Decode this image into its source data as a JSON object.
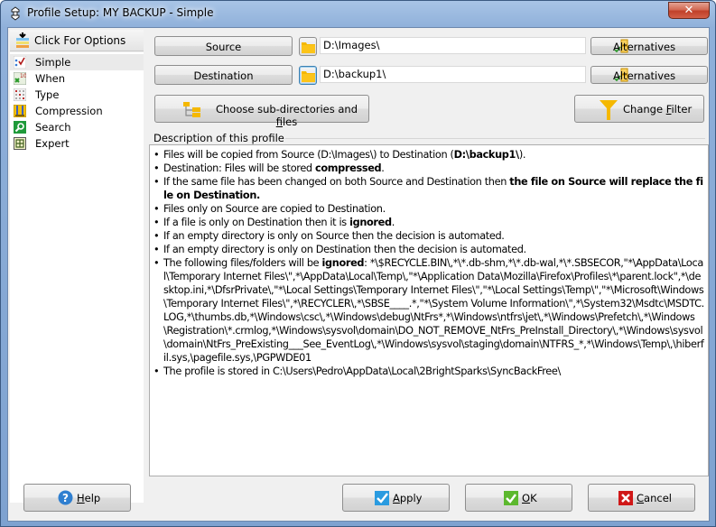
{
  "window": {
    "title": "Profile Setup: MY BACKUP - Simple",
    "close_glyph": "✕"
  },
  "sidebar": {
    "header_label": "Click For Options",
    "items": [
      {
        "label": "Simple",
        "icon": "simple-icon",
        "selected": true
      },
      {
        "label": "When",
        "icon": "when-icon",
        "selected": false
      },
      {
        "label": "Type",
        "icon": "type-icon",
        "selected": false
      },
      {
        "label": "Compression",
        "icon": "compression-icon",
        "selected": false
      },
      {
        "label": "Search",
        "icon": "search-icon",
        "selected": false
      },
      {
        "label": "Expert",
        "icon": "expert-icon",
        "selected": false
      }
    ]
  },
  "source": {
    "button_label": "Source",
    "path": "D:\\Images\\",
    "alternatives_label": "Alternatives"
  },
  "destination": {
    "button_label": "Destination",
    "path": "D:\\backup1\\",
    "alternatives_label": "Alternatives"
  },
  "choose_subdirs": {
    "label_pre": "Choose sub-directories and ",
    "label_mnemonic": "f",
    "label_post": "iles"
  },
  "change_filter": {
    "label_pre": "Change ",
    "label_mnemonic": "F",
    "label_post": "ilter"
  },
  "description": {
    "caption": "Description of this profile",
    "items": [
      {
        "parts": [
          {
            "t": "Files will be copied from Source (D:\\Images\\) to Destination ("
          },
          {
            "t": "D:\\backup1\\",
            "b": true
          },
          {
            "t": ")."
          }
        ]
      },
      {
        "parts": [
          {
            "t": "Destination: Files will be stored "
          },
          {
            "t": "compressed",
            "b": true
          },
          {
            "t": "."
          }
        ]
      },
      {
        "parts": [
          {
            "t": "If the same file has been changed on both Source and Destination then "
          },
          {
            "t": "the file on Source will replace the file on Destination.",
            "b": true
          }
        ]
      },
      {
        "parts": [
          {
            "t": "Files only on Source are copied to Destination."
          }
        ]
      },
      {
        "parts": [
          {
            "t": "If a file is only on Destination then it is "
          },
          {
            "t": "ignored",
            "b": true
          },
          {
            "t": "."
          }
        ]
      },
      {
        "parts": [
          {
            "t": "If an empty directory is only on Source then the decision is automated."
          }
        ]
      },
      {
        "parts": [
          {
            "t": "If an empty directory is only on Destination then the decision is automated."
          }
        ]
      },
      {
        "parts": [
          {
            "t": "The following files/folders will be "
          },
          {
            "t": "ignored",
            "b": true
          },
          {
            "t": ": *\\$RECYCLE.BIN\\,*\\*.db-shm,*\\*.db-wal,*\\*.SBSECOR,\"*\\AppData\\Local\\Temporary Internet Files\\\",*\\AppData\\Local\\Temp\\,\"*\\Application Data\\Mozilla\\Firefox\\Profiles\\*\\parent.lock\",*\\desktop.ini,*\\DfsrPrivate\\,\"*\\Local Settings\\Temporary Internet Files\\\",\"*\\Local Settings\\Temp\\\",\"*\\Microsoft\\Windows\\Temporary Internet Files\\\",*\\RECYCLER\\,*\\SBSE____.*,\"*\\System Volume Information\\\",*\\System32\\Msdtc\\MSDTC.LOG,*\\thumbs.db,*\\Windows\\csc\\,*\\Windows\\debug\\NtFrs*,*\\Windows\\ntfrs\\jet\\,*\\Windows\\Prefetch\\,*\\Windows\\Registration\\*.crmlog,*\\Windows\\sysvol\\domain\\DO_NOT_REMOVE_NtFrs_PreInstall_Directory\\,*\\Windows\\sysvol\\domain\\NtFrs_PreExisting___See_EventLog\\,*\\Windows\\sysvol\\staging\\domain\\NTFRS_*,*\\Windows\\Temp\\,\\hiberfil.sys,\\pagefile.sys,\\PGPWDE01"
          }
        ]
      },
      {
        "parts": [
          {
            "t": "The profile is stored in C:\\Users\\Pedro\\AppData\\Local\\2BrightSparks\\SyncBackFree\\"
          }
        ]
      }
    ]
  },
  "footer": {
    "help": {
      "mnemonic": "H",
      "rest": "elp"
    },
    "apply": {
      "mnemonic": "A",
      "rest": "pply"
    },
    "ok": {
      "mnemonic": "O",
      "rest": "K"
    },
    "cancel": {
      "mnemonic": "C",
      "rest": "ancel"
    }
  },
  "colors": {
    "folder": "#f5b800",
    "filter": "#f5b800",
    "ok_green": "#5cb82e",
    "cancel_red": "#d01818",
    "help_blue": "#2f7fd0",
    "apply_blue": "#2a9be0"
  }
}
